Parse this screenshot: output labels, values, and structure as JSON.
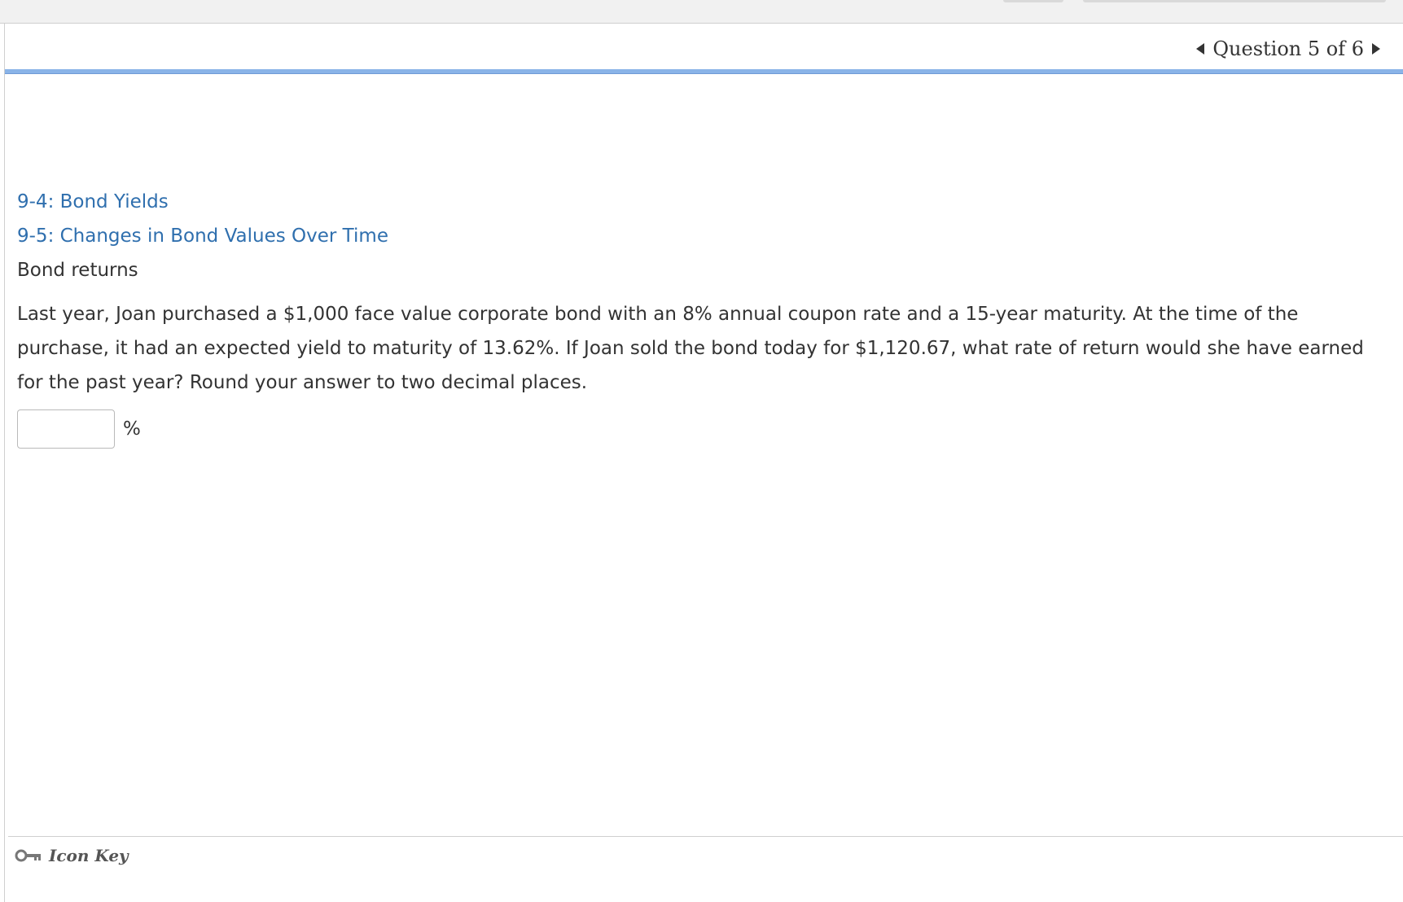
{
  "header": {
    "question_counter": "Question 5 of 6"
  },
  "topics": [
    {
      "label": "9-4: Bond Yields"
    },
    {
      "label": "9-5: Changes in Bond Values Over Time"
    }
  ],
  "problem": {
    "title": "Bond returns",
    "text": "Last year, Joan purchased a $1,000 face value corporate bond with an 8% annual coupon rate and a 15-year maturity. At the time of the purchase, it had an expected yield to maturity of 13.62%. If Joan sold the bond today for $1,120.67, what rate of return would she have earned for the past year? Round your answer to two decimal places.",
    "answer_value": "",
    "answer_unit": "%"
  },
  "footer": {
    "icon_key_label": "Icon Key"
  },
  "colors": {
    "link": "#2f6fae",
    "accent_rule": "#8ab4e8",
    "text": "#333333"
  },
  "icons": {
    "prev": "caret-left-icon",
    "next": "caret-right-icon",
    "key": "key-icon"
  }
}
